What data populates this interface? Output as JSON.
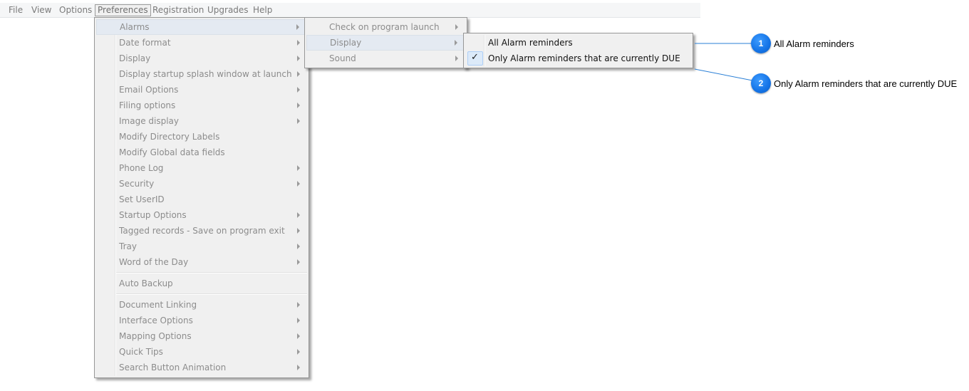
{
  "menubar": {
    "items": [
      "File",
      "View",
      "Options",
      "Preferences",
      "Registration",
      "Upgrades",
      "Help"
    ]
  },
  "preferences_menu": {
    "items": [
      "Alarms",
      "Date format",
      "Display",
      "Display startup splash window at launch",
      "Email Options",
      "Filing options",
      "Image display",
      "Modify Directory Labels",
      "Modify Global data fields",
      "Phone Log",
      "Security",
      "Set UserID",
      "Startup Options",
      "Tagged records - Save on program exit",
      "Tray",
      "Word of the Day",
      "Auto Backup",
      "Document Linking",
      "Interface Options",
      "Mapping Options",
      "Quick Tips",
      "Search Button Animation"
    ]
  },
  "alarms_menu": {
    "items": [
      "Check on program launch",
      "Display",
      "Sound"
    ]
  },
  "display_menu": {
    "items": [
      "All Alarm reminders",
      "Only Alarm reminders that are currently DUE"
    ],
    "check_glyph": "✓"
  },
  "callouts": [
    {
      "number": "1",
      "text": "All Alarm reminders"
    },
    {
      "number": "2",
      "text": "Only Alarm reminders that are currently DUE"
    }
  ],
  "colors": {
    "badge": "#1473e6",
    "callout_line": "#2a7fd6",
    "menu_bg": "#f0f0f0",
    "disabled_text": "#8c8c8c"
  }
}
